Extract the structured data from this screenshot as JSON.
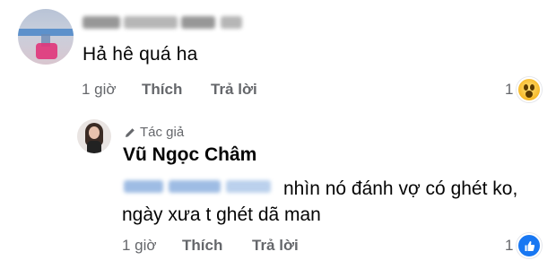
{
  "comment": {
    "text": "Hả hê quá ha",
    "time": "1 giờ",
    "like_label": "Thích",
    "reply_label": "Trả lời",
    "reaction_count": "1",
    "reaction_icon": "wow-icon"
  },
  "reply": {
    "badge": "Tác giả",
    "author": "Vũ Ngọc Châm",
    "text_line1": "nhìn nó đánh vợ có ghét ko,",
    "text_line2": "ngày xưa t ghét dã man",
    "time": "1 giờ",
    "like_label": "Thích",
    "reply_label": "Trả lời",
    "reaction_count": "1",
    "reaction_icon": "like-icon"
  },
  "colors": {
    "secondary_text": "#65676b",
    "like_blue": "#1877f2",
    "primary_text": "#050505"
  }
}
